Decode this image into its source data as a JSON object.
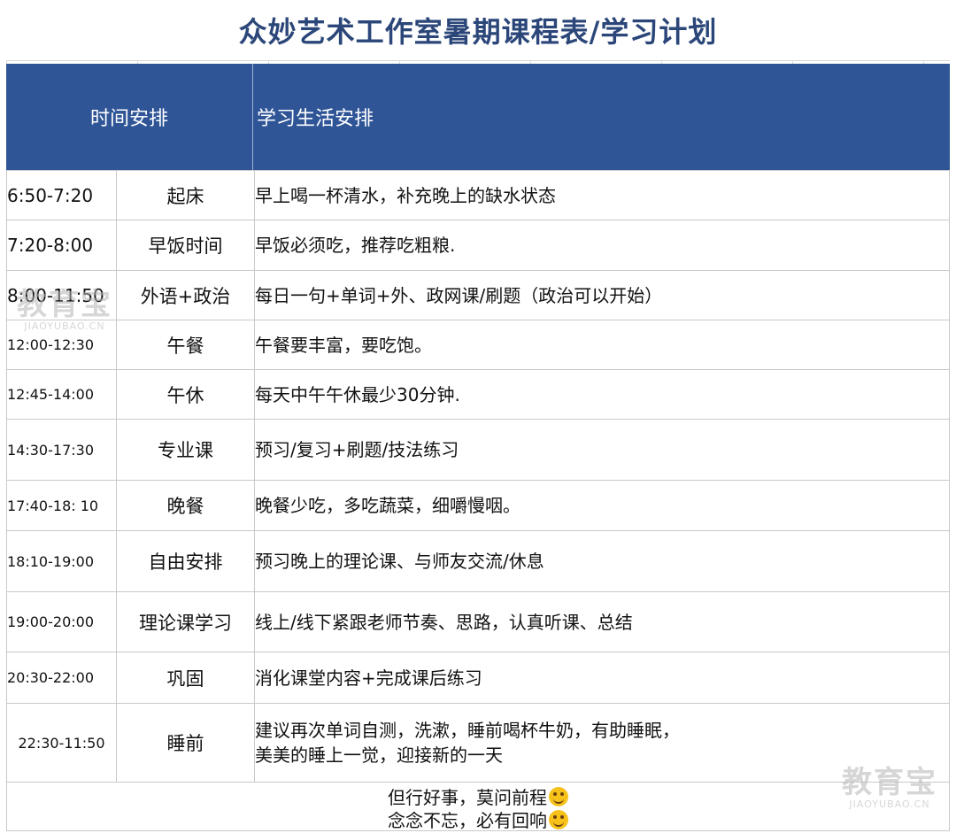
{
  "title": "众妙艺术工作室暑期课程表/学习计划",
  "header": {
    "col_time": "时间安排",
    "col_plan": "学习生活安排"
  },
  "rows": [
    {
      "time": "6:50-7:20",
      "activity": "起床",
      "note": [
        "早上喝一杯清水，补充晚上的缺水状态"
      ]
    },
    {
      "time": "7:20-8:00",
      "activity": "早饭时间",
      "note": [
        "早饭必须吃，推荐吃粗粮."
      ]
    },
    {
      "time": "8:00-11:50",
      "activity": "外语+政治",
      "note": [
        "每日一句+单词+外、政网课/刷题（政治可以开始）"
      ]
    },
    {
      "time": "12:00-12:30",
      "activity": "午餐",
      "note": [
        "午餐要丰富，要吃饱。"
      ]
    },
    {
      "time": "12:45-14:00",
      "activity": "午休",
      "note": [
        "每天中午午休最少30分钟."
      ]
    },
    {
      "time": "14:30-17:30",
      "activity": "专业课",
      "note": [
        "预习/复习+刷题/技法练习"
      ]
    },
    {
      "time": "17:40-18: 10",
      "activity": "晚餐",
      "note": [
        "晚餐少吃，多吃蔬菜，细嚼慢咽。"
      ]
    },
    {
      "time": "18:10-19:00",
      "activity": "自由安排",
      "note": [
        "预习晚上的理论课、与师友交流/休息"
      ]
    },
    {
      "time": "19:00-20:00",
      "activity": "理论课学习",
      "note": [
        "线上/线下紧跟老师节奏、思路，认真听课、总结"
      ]
    },
    {
      "time": "20:30-22:00",
      "activity": "巩固",
      "note": [
        "消化课堂内容+完成课后练习"
      ]
    },
    {
      "time": "22:30-11:50",
      "activity": "睡前",
      "note": [
        "建议再次单词自测，洗漱，睡前喝杯牛奶，有助睡眠，",
        "美美的睡上一觉，迎接新的一天"
      ]
    }
  ],
  "footer": {
    "line1": "但行好事，莫问前程",
    "line2": "念念不忘，必有回响"
  },
  "watermark": {
    "brand": "教育宝",
    "site": "JIAOYUBAO.CN"
  },
  "icons": {
    "emoji1": "grinning-face-icon",
    "emoji2": "smirking-face-icon"
  },
  "colors": {
    "header_bg": "#2f5597",
    "title": "#2b4679",
    "emoji": "#f6c21a"
  }
}
